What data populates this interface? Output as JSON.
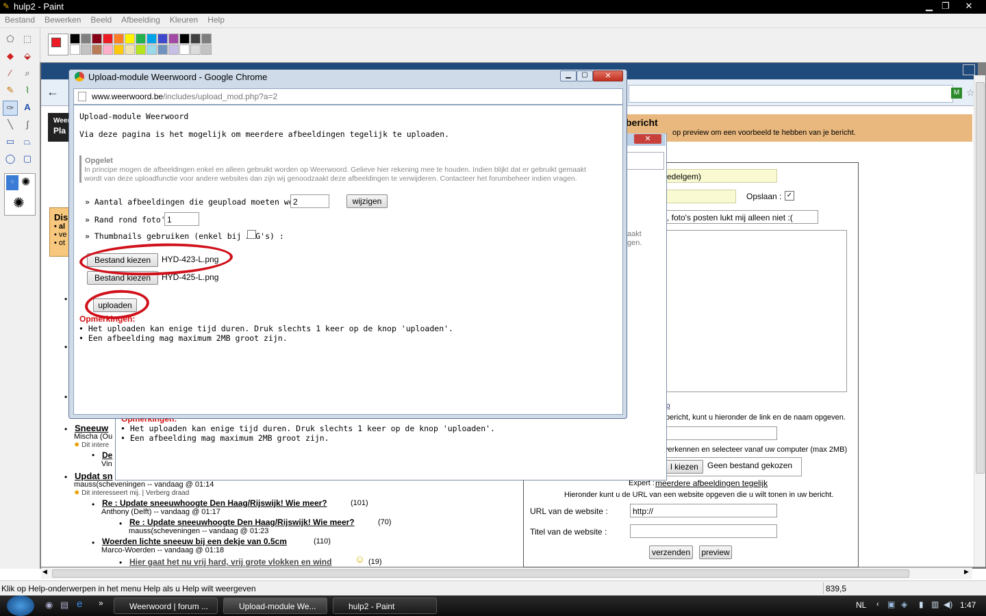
{
  "paint": {
    "title": "hulp2 - Paint",
    "menu": [
      "Bestand",
      "Bewerken",
      "Beeld",
      "Afbeelding",
      "Kleuren",
      "Help"
    ],
    "status_help": "Klik op Help-onderwerpen in het menu Help als u Help wilt weergeven",
    "status_coords": "839,5",
    "palette_top": [
      "#000000",
      "#7f7f7f",
      "#880015",
      "#ed1c24",
      "#ff7f27",
      "#fff200",
      "#22b14c",
      "#00a2e8",
      "#3f48cc",
      "#a349a4",
      "#000000",
      "#404040",
      "#7f7f7f"
    ],
    "palette_bottom": [
      "#ffffff",
      "#c3c3c3",
      "#b97a57",
      "#ffaec9",
      "#ffc90e",
      "#efe4b0",
      "#b5e61d",
      "#99d9ea",
      "#7092be",
      "#c8bfe7",
      "#ffffff",
      "#dcdcdc",
      "#c3c3c3"
    ],
    "primary_color": "#ed1c24"
  },
  "popup": {
    "title": "Upload-module Weerwoord - Google Chrome",
    "url_domain": "www.weerwoord.be",
    "url_path": "/includes/upload_mod.php?a=2",
    "heading": "Upload-module Weerwoord",
    "intro": "Via deze pagina is het mogelijk om meerdere afbeeldingen tegelijk te uploaden.",
    "note_title": "Opgelet",
    "note_line1": "In principe mogen de afbeeldingen enkel en alleen gebruikt worden op Weerwoord. Gelieve hier rekening mee te houden. Indien blijkt dat er gebruikt gemaakt",
    "note_line2": "wordt van deze uploadfunctie voor andere websites dan zijn wij genoodzaakt deze afbeeldingen te verwijderen. Contacteer het forumbeheer indien vragen.",
    "count_label": "» Aantal afbeeldingen die geupload moeten worden :",
    "count_value": "2",
    "change_button": "wijzigen",
    "border_label": "» Rand rond foto's :",
    "border_value": "1",
    "thumbs_label": "» Thumbnails gebruiken (enkel bij JPG's) :",
    "file_button": "Bestand kiezen",
    "file1": "HYD-423-L.png",
    "file2": "HYD-425-L.png",
    "upload_button": "uploaden",
    "remarks_title": "Opmerkingen:",
    "remark1": "Het uploaden kan enige tijd duren. Druk slechts 1 keer op de knop 'uploaden'.",
    "remark2": "Een afbeelding mag maximum 2MB groot zijn."
  },
  "popup2": {
    "remarks_title": "Opmerkingen:",
    "remark1": "Het uploaden kan enige tijd duren. Druk slechts 1 keer op de knop 'uploaden'.",
    "remark2": "Een afbeelding mag maximum 2MB groot zijn.",
    "side1": "aakt",
    "side2": "gen."
  },
  "background": {
    "header_title": "bericht",
    "header_sub": "op preview om een voorbeeld te hebben van je bericht.",
    "name_value": "edelgem)",
    "save_label": "Opslaan :",
    "subject_value": ", foto's posten lukt mij alleen niet :(",
    "help_link": "lp",
    "link_hint": "bericht, kunt u hieronder de link en de naam opgeven.",
    "file_hint": "verkennen en selecteer vanaf uw computer (max 2MB)",
    "file_button": "l kiezen",
    "no_file": "Geen bestand gekozen",
    "expert_label": "Expert :",
    "expert_link": "meerdere afbeeldingen tegelijk",
    "url_hint": "Hieronder kunt u de URL van een website opgeven die u wilt tonen in uw bericht.",
    "url_label": "URL van de website :",
    "url_value": "http://",
    "site_title_label": "Titel van de website :",
    "send_button": "verzenden",
    "preview_button": "preview",
    "side_logo": "Weer",
    "side_logo2": "Pla",
    "side_box_title": "Dis",
    "side_box_1": "• al",
    "side_box_2": "• ve",
    "side_box_3": "• ot",
    "threads": [
      {
        "title": "Sneeuw",
        "author": "Mischa (Ou",
        "meta": "Dit intere"
      },
      {
        "title": "De",
        "author": "Vin",
        "meta": ""
      },
      {
        "title": "Updat sn",
        "author": "mauss(scheveningen  --  vandaag @ 01:14",
        "meta": "Dit interesseert mij. | Verberg draad"
      }
    ],
    "replies": [
      {
        "title": "Re : Update sneeuwhoogte Den Haag/Rijswijk! Wie meer?",
        "count": "(101)",
        "author": "Anthony (Delft)  --  vandaag @ 01:17"
      },
      {
        "title": "Re : Update sneeuwhoogte Den Haag/Rijswijk! Wie meer?",
        "count": "(70)",
        "author": "mauss(scheveningen  --  vandaag @ 01:23"
      },
      {
        "title": "Woerden lichte sneeuw bij een dekje van 0.5cm",
        "count": "(110)",
        "author": "Marco-Woerden  --  vandaag @ 01:18"
      },
      {
        "title": "Hier gaat het nu vrij hard, vrij grote vlokken en wind",
        "count": "(19)",
        "author": ""
      }
    ]
  },
  "taskbar": {
    "tasks": [
      "Weerwoord | forum ...",
      "Upload-module We...",
      "hulp2 - Paint"
    ],
    "lang": "NL",
    "time": "1:47"
  }
}
